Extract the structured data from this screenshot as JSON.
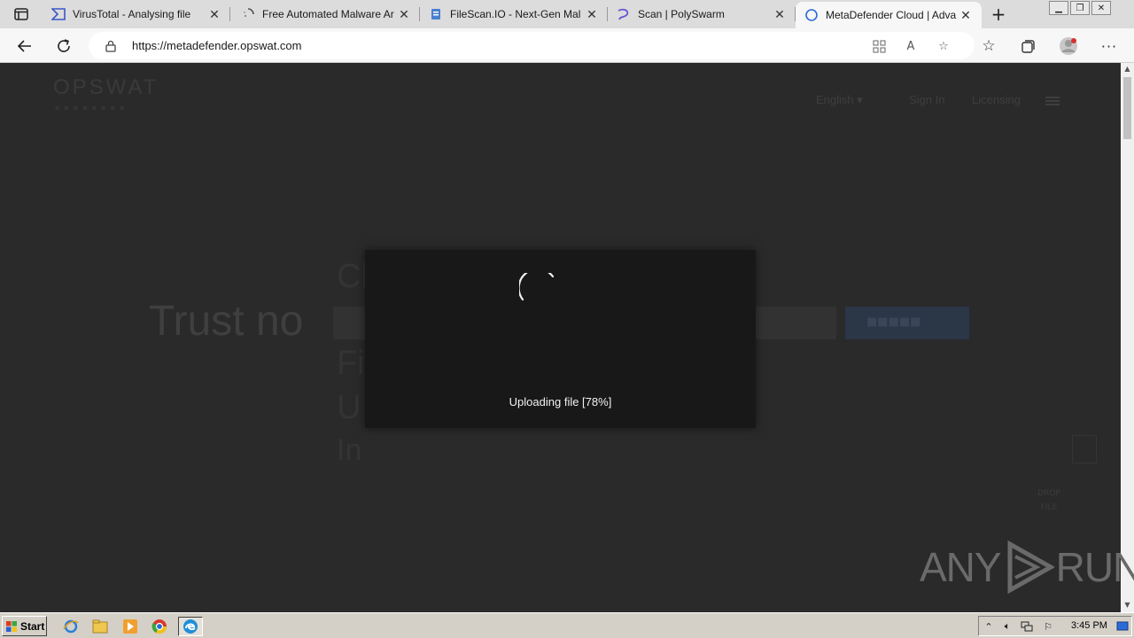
{
  "browser": {
    "tabs": [
      {
        "title": "VirusTotal - Analysing file",
        "icon": "virustotal-icon",
        "active": false
      },
      {
        "title": "Free Automated Malware Ar",
        "icon": "loading-icon",
        "active": false
      },
      {
        "title": "FileScan.IO - Next-Gen Mal",
        "icon": "filescan-icon",
        "active": false
      },
      {
        "title": "Scan | PolySwarm",
        "icon": "polyswarm-icon",
        "active": false
      },
      {
        "title": "MetaDefender Cloud | Adva",
        "icon": "loading-icon",
        "active": true
      }
    ],
    "url": "https://metadefender.opswat.com"
  },
  "page": {
    "logo": "OPSWAT",
    "nav": {
      "language": "English",
      "signin": "Sign In",
      "licensing": "Licensing"
    },
    "hero_text": "Trust no",
    "bg_lines": [
      "Cl",
      "Fi",
      "U",
      "In"
    ],
    "drop_label": "DROP FILE"
  },
  "modal": {
    "status_text": "Uploading file [78%]",
    "progress_percent": 78
  },
  "watermark": {
    "left": "ANY",
    "right": "RUN"
  },
  "taskbar": {
    "start_label": "Start",
    "clock": "3:45 PM"
  }
}
